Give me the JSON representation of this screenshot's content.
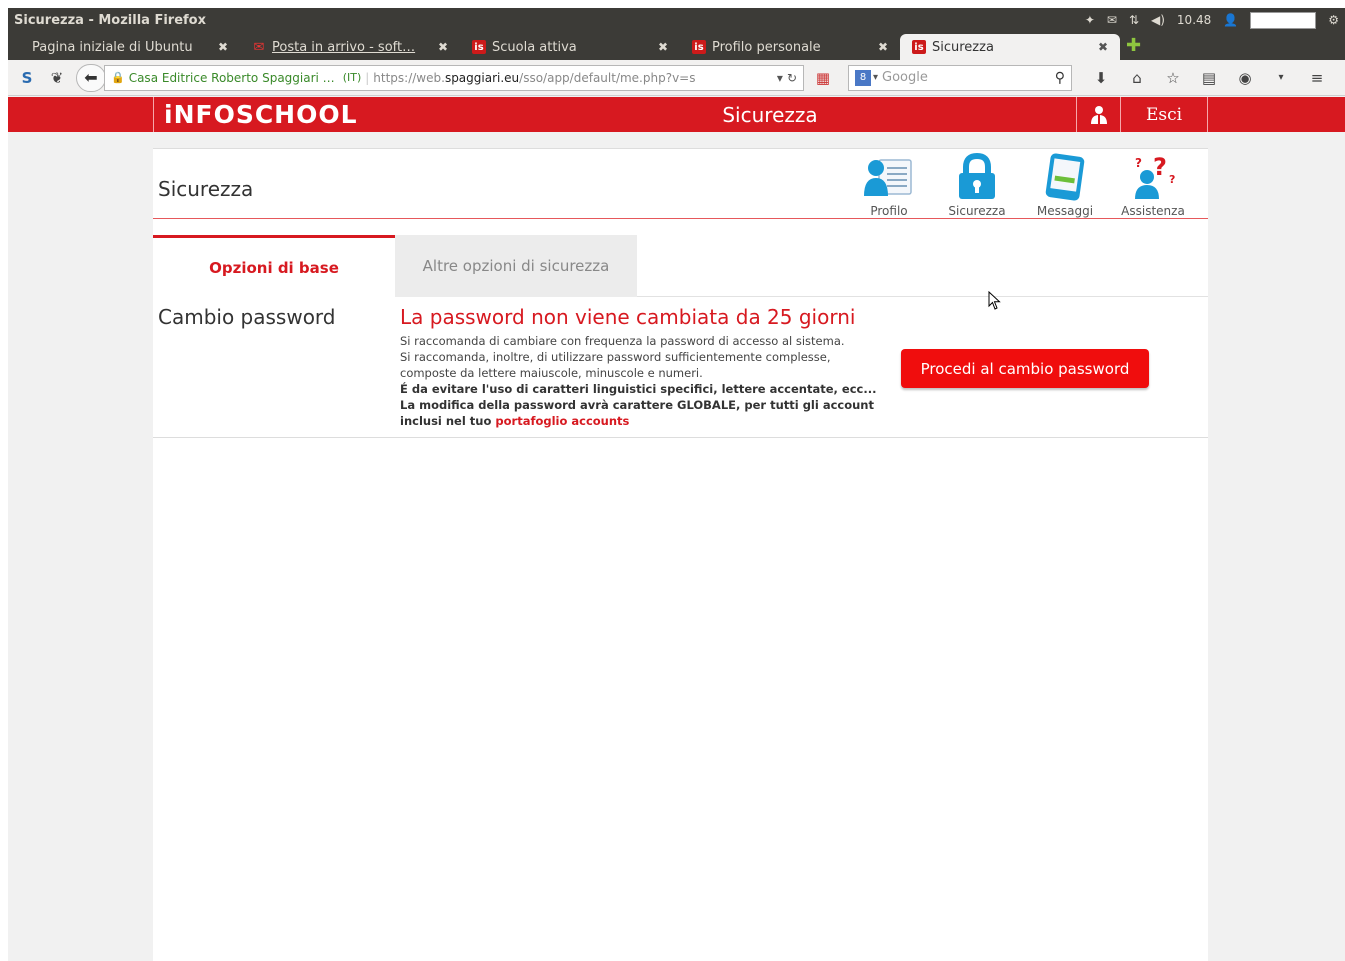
{
  "window": {
    "title": "Sicurezza - Mozilla Firefox"
  },
  "tray": {
    "time": "10.48"
  },
  "tabs": [
    {
      "label": "Pagina iniziale di Ubuntu",
      "icon": "none",
      "active": false
    },
    {
      "label": "Posta in arrivo - soft…",
      "icon": "mail-icon",
      "active": false
    },
    {
      "label": "Scuola attiva",
      "icon": "is-logo-icon",
      "active": false
    },
    {
      "label": "Profilo personale",
      "icon": "is-logo-icon",
      "active": false
    },
    {
      "label": "Sicurezza",
      "icon": "is-logo-icon",
      "active": true
    }
  ],
  "navbar": {
    "identity": "Casa Editrice Roberto Spaggiari …",
    "country": "(IT)",
    "url_prefix": "https://web.",
    "url_domain": "spaggiari.eu",
    "url_rest": "/sso/app/default/me.php?v=s",
    "search_placeholder": "Google"
  },
  "app": {
    "logo": "iNFOSCHOOL",
    "page_title": "Sicurezza",
    "logout_label": "Esci"
  },
  "section": {
    "title": "Sicurezza",
    "nav": [
      {
        "label": "Profilo",
        "icon": "profile-card-icon"
      },
      {
        "label": "Sicurezza",
        "icon": "padlock-icon"
      },
      {
        "label": "Messaggi",
        "icon": "phone-message-icon"
      },
      {
        "label": "Assistenza",
        "icon": "help-question-icon"
      }
    ]
  },
  "content_tabs": {
    "basic": "Opzioni di base",
    "other": "Altre opzioni di sicurezza"
  },
  "password": {
    "label": "Cambio password",
    "warning": "La password non viene cambiata da 25 giorni",
    "line1": "Si raccomanda di cambiare con frequenza la password di accesso al sistema.",
    "line2": "Si raccomanda, inoltre, di utilizzare password sufficientemente complesse,",
    "line3": "composte da lettere maiuscole, minuscole e numeri.",
    "line4": "É da evitare l'uso di caratteri linguistici specifici, lettere accentate, ecc...",
    "line5": "La modifica della password avrà carattere GLOBALE, per tutti gli account",
    "line6_prefix": "inclusi nel tuo",
    "line6_link": "portafoglio accounts",
    "button": "Procedi al cambio password"
  },
  "colors": {
    "brand_red": "#d71920",
    "button_red": "#f00d0d",
    "icon_blue": "#1a9ad6"
  }
}
